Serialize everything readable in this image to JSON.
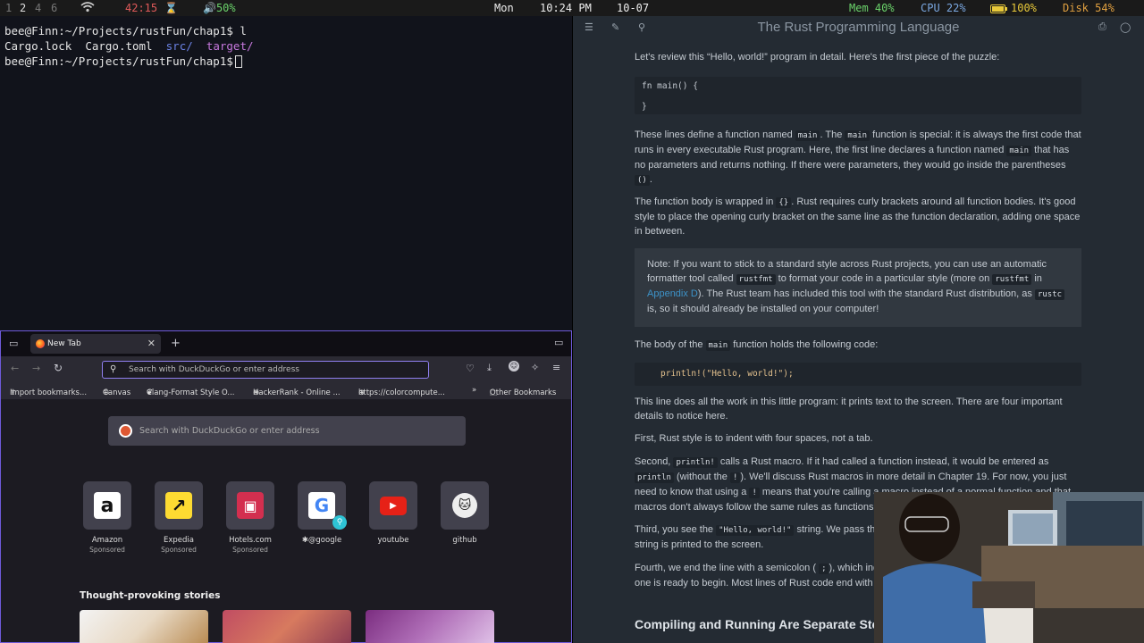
{
  "topbar": {
    "workspaces": [
      "1",
      "2",
      "4",
      "6"
    ],
    "wifi_icon": "wifi-icon",
    "timer": "42:15",
    "timer_icon": "hourglass-icon",
    "volume": "50%",
    "day": "Mon",
    "time": "10:24 PM",
    "date": "10-07",
    "mem": "Mem 40%",
    "cpu": "CPU 22%",
    "battery": "100%",
    "disk": "Disk 54%"
  },
  "terminal": {
    "prompt1": "bee@Finn:~/Projects/rustFun/chap1$ l",
    "ls_files": [
      "Cargo.lock",
      "Cargo.toml"
    ],
    "ls_dirs": [
      "src/",
      "target/"
    ],
    "prompt2": "bee@Finn:~/Projects/rustFun/chap1$"
  },
  "browser": {
    "tab_title": "New Tab",
    "url_placeholder": "Search with DuckDuckGo or enter address",
    "bookmarks": [
      "Import bookmarks...",
      "Canvas",
      "Clang-Format Style O...",
      "HackerRank - Online ...",
      "https://colorcompute...",
      "Other Bookmarks"
    ],
    "search_placeholder": "Search with DuckDuckGo or enter address",
    "shortcuts": [
      {
        "name": "Amazon",
        "sub": "Sponsored"
      },
      {
        "name": "Expedia",
        "sub": "Sponsored"
      },
      {
        "name": "Hotels.com",
        "sub": "Sponsored"
      },
      {
        "name": "@google",
        "sub": ""
      },
      {
        "name": "youtube",
        "sub": ""
      },
      {
        "name": "github",
        "sub": ""
      }
    ],
    "stories_heading": "Thought-provoking stories",
    "accent": "#8f7ff0"
  },
  "book": {
    "title": "The Rust Programming Language",
    "p1": "Let's review this “Hello, world!” program in detail. Here's the first piece of the puzzle:",
    "code1_line1": "fn main() {",
    "code1_line2": "}",
    "p2a": "These lines define a function named",
    "p2_code1": "main",
    "p2b": ". The",
    "p2_code2": "main",
    "p2c": "function is special: it is always the first code that runs in every executable Rust program. Here, the first line declares a function named",
    "p2_code3": "main",
    "p2d": "that has no parameters and returns nothing. If there were parameters, they would go inside the parentheses",
    "p2_code4": "()",
    "p2e": ".",
    "p3a": "The function body is wrapped in",
    "p3_code": "{}",
    "p3b": ". Rust requires curly brackets around all function bodies. It's good style to place the opening curly bracket on the same line as the function declaration, adding one space in between.",
    "note_a": "Note: If you want to stick to a standard style across Rust projects, you can use an automatic formatter tool called",
    "note_code1": "rustfmt",
    "note_b": "to format your code in a particular style (more on",
    "note_code2": "rustfmt",
    "note_c": "in",
    "note_link": "Appendix D",
    "note_d": "). The Rust team has included this tool with the standard Rust distribution, as",
    "note_code3": "rustc",
    "note_e": "is, so it should already be installed on your computer!",
    "p4a": "The body of the",
    "p4_code": "main",
    "p4b": "function holds the following code:",
    "code2": "println!(\"Hello, world!\");",
    "p5": "This line does all the work in this little program: it prints text to the screen. There are four important details to notice here.",
    "p6": "First, Rust style is to indent with four spaces, not a tab.",
    "p7a": "Second,",
    "p7_code1": "println!",
    "p7b": "calls a Rust macro. If it had called a function instead, it would be entered as",
    "p7_code2": "println",
    "p7c": "(without the",
    "p7_code3": "!",
    "p7d": "). We'll discuss Rust macros in more detail in Chapter 19. For now, you just need to know that using a",
    "p7_code4": "!",
    "p7e": "means that you're calling a macro instead of a normal function and that macros don't always follow the same rules as functions.",
    "p8a": "Third, you see the",
    "p8_code": "\"Hello, world!\"",
    "p8b": "string. We pass this string as an argument to println!, and the string is printed to the screen.",
    "p9a": "Fourth, we end the line with a semicolon (",
    "p9_code": ";",
    "p9b": "), which indicates that this expression is over and the next one is ready to begin. Most lines of Rust code end with a semicolon.",
    "h2": "Compiling and Running Are Separate Steps"
  }
}
